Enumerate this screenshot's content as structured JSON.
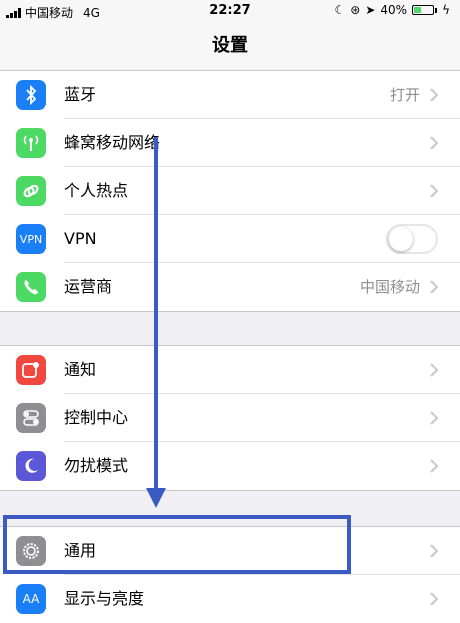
{
  "status_bar": {
    "carrier": "中国移动",
    "network": "4G",
    "time": "22:27",
    "battery_percent": "40%",
    "battery_level": 0.4
  },
  "nav": {
    "title": "设置"
  },
  "group1": [
    {
      "label": "蓝牙",
      "value": "打开",
      "icon": "bluetooth-icon",
      "color": "#1a7ef6"
    },
    {
      "label": "蜂窝移动网络",
      "value": "",
      "icon": "cellular-antenna-icon",
      "color": "#4cd964"
    },
    {
      "label": "个人热点",
      "value": "",
      "icon": "hotspot-chain-icon",
      "color": "#4cd964"
    },
    {
      "label": "VPN",
      "value": "",
      "icon": "vpn-icon",
      "icon_text": "VPN",
      "color": "#1a7ef6",
      "toggle_on": false
    },
    {
      "label": "运营商",
      "value": "中国移动",
      "icon": "phone-icon",
      "color": "#4cd964"
    }
  ],
  "group2": [
    {
      "label": "通知",
      "icon": "notification-icon",
      "color": "#f2473f"
    },
    {
      "label": "控制中心",
      "icon": "control-center-icon",
      "color": "#8e8e93"
    },
    {
      "label": "勿扰模式",
      "icon": "moon-icon",
      "color": "#5b57d6"
    }
  ],
  "group3": [
    {
      "label": "通用",
      "icon": "gear-icon",
      "color": "#8e8e93"
    },
    {
      "label": "显示与亮度",
      "icon": "display-aa-icon",
      "icon_text": "AA",
      "color": "#1a7ef6"
    }
  ],
  "annotation": {
    "color": "#3b5bc4"
  }
}
